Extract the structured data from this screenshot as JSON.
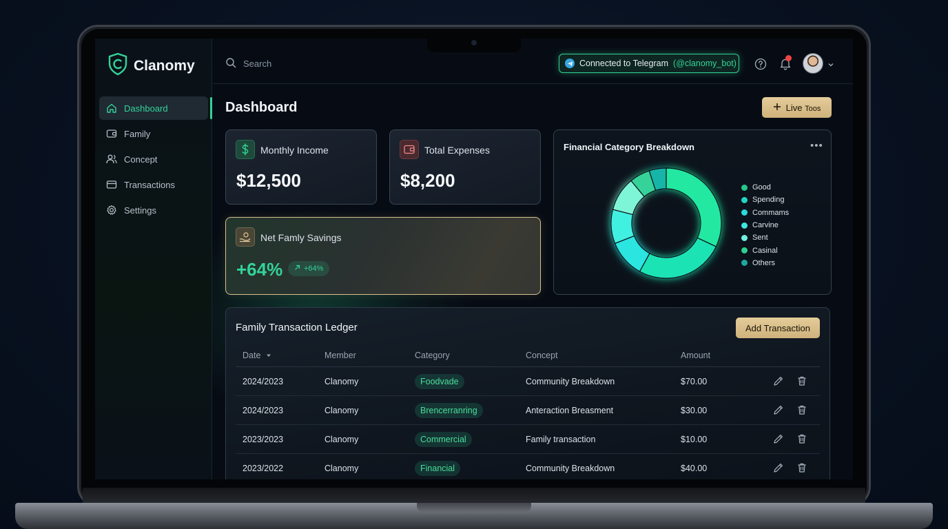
{
  "brand": {
    "name": "Clanomy"
  },
  "sidebar": {
    "items": [
      {
        "label": "Dashboard",
        "icon": "home-icon",
        "active": true
      },
      {
        "label": "Family",
        "icon": "wallet-icon"
      },
      {
        "label": "Concept",
        "icon": "users-icon"
      },
      {
        "label": "Transactions",
        "icon": "card-icon"
      },
      {
        "label": "Settings",
        "icon": "gear-icon"
      }
    ]
  },
  "topbar": {
    "search_placeholder": "Search",
    "telegram_text": "Connected to Telegram",
    "telegram_handle": "(@clanomy_bot)"
  },
  "page": {
    "title": "Dashboard",
    "live_button": "Live",
    "live_button_small": "Toos"
  },
  "stats": {
    "income": {
      "label": "Monthly Income",
      "value": "$12,500"
    },
    "expenses": {
      "label": "Total Expenses",
      "value": "$8,200"
    },
    "savings": {
      "label": "Net Famly Savings",
      "value": "+64%",
      "pill": "+64%"
    }
  },
  "chart_data": {
    "type": "pie",
    "title": "Financial Category Breakdown",
    "categories": [
      "Good",
      "Spending",
      "Commams",
      "Carvine",
      "Sent",
      "Casinal",
      "Others"
    ],
    "values": [
      32,
      26,
      11,
      10,
      10,
      6,
      5
    ],
    "colors": [
      "#22e8a2",
      "#1fe3b4",
      "#29e5e0",
      "#3ff0e0",
      "#7ff5d8",
      "#34d399",
      "#17b5a8"
    ],
    "legend_position": "right"
  },
  "legend_colors": [
    "#22c98a",
    "#22d6c7",
    "#2ad9dd",
    "#3ee6e0",
    "#6ef0e0",
    "#2fcf92",
    "#1ba8a0"
  ],
  "ledger": {
    "title": "Family Transaction Ledger",
    "add_button": "Add Transaction",
    "columns": {
      "date": "Date",
      "member": "Member",
      "category": "Category",
      "concept": "Concept",
      "amount": "Amount"
    },
    "rows": [
      {
        "date": "2024/2023",
        "member": "Clanomy",
        "category": "Foodvade",
        "concept": "Community Breakdown",
        "amount": "$70.00"
      },
      {
        "date": "2024/2023",
        "member": "Clanomy",
        "category": "Brencerranring",
        "concept": "Anteraction Breasment",
        "amount": "$30.00"
      },
      {
        "date": "2023/2023",
        "member": "Clanomy",
        "category": "Commercial",
        "concept": "Family transaction",
        "amount": "$10.00"
      },
      {
        "date": "2023/2022",
        "member": "Clanomy",
        "category": "Financial",
        "concept": "Community Breakdown",
        "amount": "$40.00"
      }
    ]
  },
  "colors": {
    "accent": "#34d399",
    "gold": "#d8c28f",
    "alert": "#ef4444"
  }
}
